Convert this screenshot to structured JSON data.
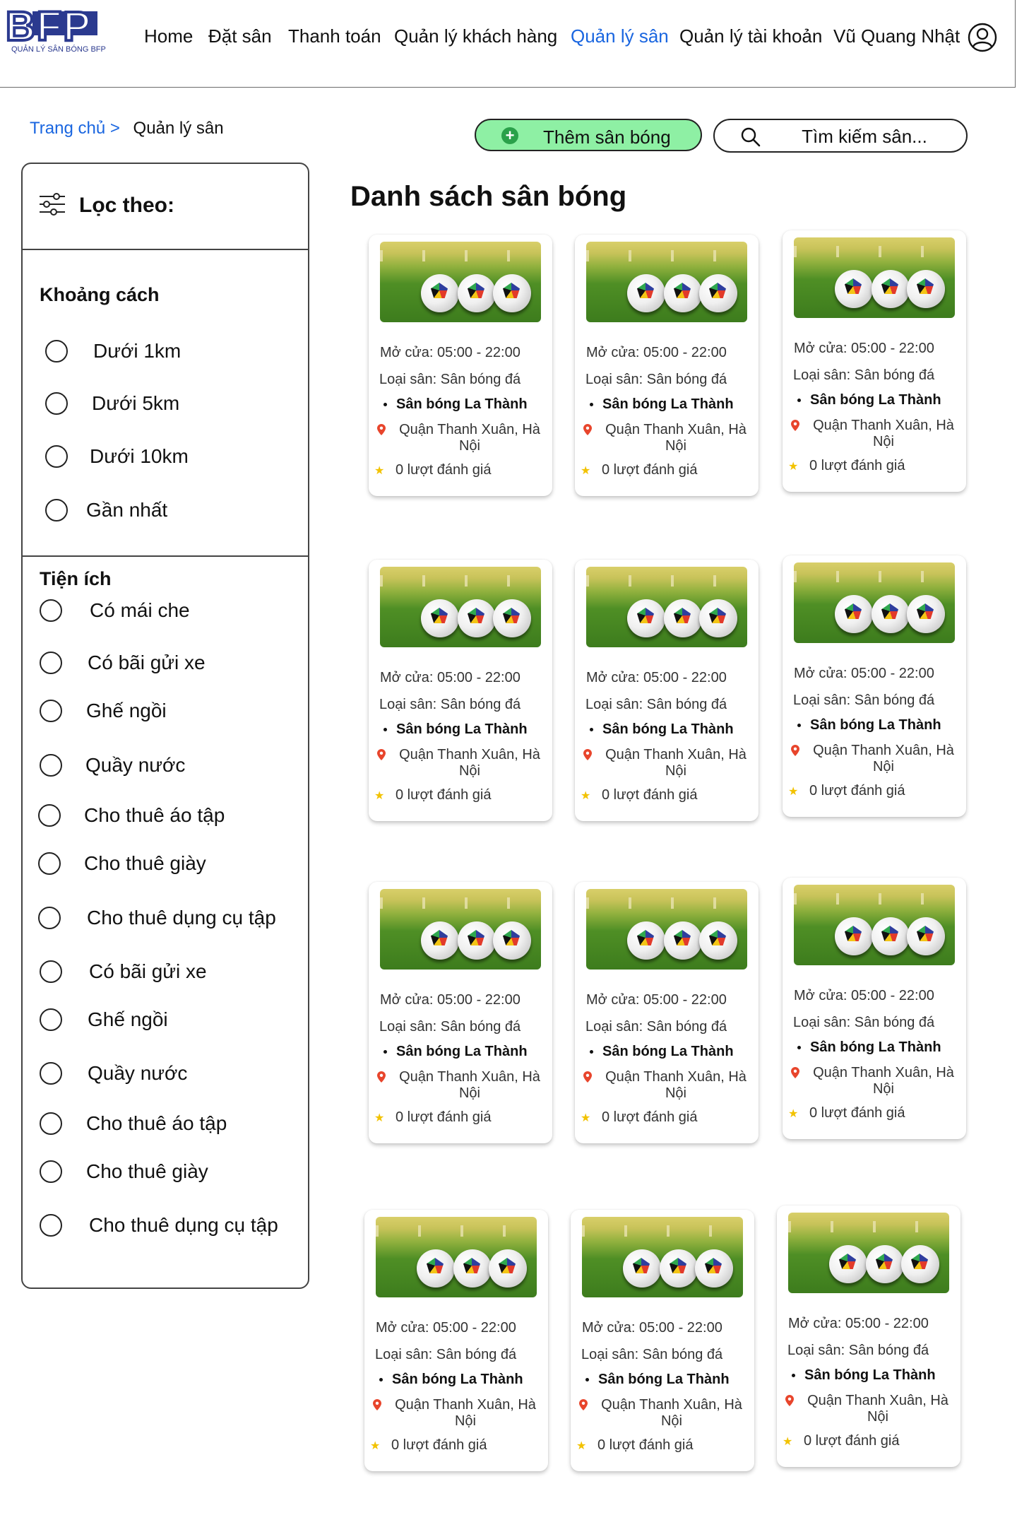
{
  "header": {
    "logo_text": "BFP",
    "logo_subtitle": "QUẢN LÝ SÂN BÓNG BFP",
    "nav": [
      {
        "label": "Home",
        "active": false
      },
      {
        "label": "Đặt sân",
        "active": false
      },
      {
        "label": "Thanh toán",
        "active": false
      },
      {
        "label": "Quản lý khách hàng",
        "active": false
      },
      {
        "label": "Quản lý sân",
        "active": true
      },
      {
        "label": "Quản lý tài khoản",
        "active": false
      },
      {
        "label": "Vũ Quang Nhật",
        "active": false
      }
    ]
  },
  "breadcrumb": {
    "home": "Trang chủ >",
    "current": "Quản lý sân"
  },
  "toolbar": {
    "add_label": "Thêm sân bóng",
    "search_placeholder": "Tìm kiếm sân..."
  },
  "filter": {
    "title": "Lọc theo:",
    "distance_title": "Khoảng cách",
    "distance_options": [
      "Dưới 1km",
      "Dưới 5km",
      "Dưới 10km",
      "Gần nhất"
    ],
    "amenities_title": "Tiện ích",
    "amenity_options": [
      "Có mái che",
      "Có bãi gửi xe",
      "Ghế ngồi",
      "Quầy nước",
      "Cho thuê áo tập",
      "Cho thuê giày",
      "Cho thuê dụng cụ tập",
      "Có bãi gửi xe",
      "Ghế ngồi",
      "Quầy nước",
      "Cho thuê áo tập",
      "Cho thuê giày",
      "Cho thuê dụng cụ tập"
    ]
  },
  "main": {
    "title": "Danh sách sân bóng",
    "cards": [
      {
        "open": "Mở cửa: 05:00 - 22:00",
        "type": "Loại sân: Sân bóng đá",
        "name": "Sân bóng La Thành",
        "address": "Quận Thanh Xuân, Hà Nội",
        "rating": "0 lượt đánh giá"
      },
      {
        "open": "Mở cửa: 05:00 - 22:00",
        "type": "Loại sân: Sân bóng đá",
        "name": "Sân bóng La Thành",
        "address": "Quận Thanh Xuân, Hà Nội",
        "rating": "0 lượt đánh giá"
      },
      {
        "open": "Mở cửa: 05:00 - 22:00",
        "type": "Loại sân: Sân bóng đá",
        "name": "Sân bóng La Thành",
        "address": "Quận Thanh Xuân, Hà Nội",
        "rating": "0 lượt đánh giá"
      },
      {
        "open": "Mở cửa: 05:00 - 22:00",
        "type": "Loại sân: Sân bóng đá",
        "name": "Sân bóng La Thành",
        "address": "Quận Thanh Xuân, Hà Nội",
        "rating": "0 lượt đánh giá"
      },
      {
        "open": "Mở cửa: 05:00 - 22:00",
        "type": "Loại sân: Sân bóng đá",
        "name": "Sân bóng La Thành",
        "address": "Quận Thanh Xuân, Hà Nội",
        "rating": "0 lượt đánh giá"
      },
      {
        "open": "Mở cửa: 05:00 - 22:00",
        "type": "Loại sân: Sân bóng đá",
        "name": "Sân bóng La Thành",
        "address": "Quận Thanh Xuân, Hà Nội",
        "rating": "0 lượt đánh giá"
      },
      {
        "open": "Mở cửa: 05:00 - 22:00",
        "type": "Loại sân: Sân bóng đá",
        "name": "Sân bóng La Thành",
        "address": "Quận Thanh Xuân, Hà Nội",
        "rating": "0 lượt đánh giá"
      },
      {
        "open": "Mở cửa: 05:00 - 22:00",
        "type": "Loại sân: Sân bóng đá",
        "name": "Sân bóng La Thành",
        "address": "Quận Thanh Xuân, Hà Nội",
        "rating": "0 lượt đánh giá"
      },
      {
        "open": "Mở cửa: 05:00 - 22:00",
        "type": "Loại sân: Sân bóng đá",
        "name": "Sân bóng La Thành",
        "address": "Quận Thanh Xuân, Hà Nội",
        "rating": "0 lượt đánh giá"
      },
      {
        "open": "Mở cửa: 05:00 - 22:00",
        "type": "Loại sân: Sân bóng đá",
        "name": "Sân bóng La Thành",
        "address": "Quận Thanh Xuân, Hà Nội",
        "rating": "0 lượt đánh giá"
      },
      {
        "open": "Mở cửa: 05:00 - 22:00",
        "type": "Loại sân: Sân bóng đá",
        "name": "Sân bóng La Thành",
        "address": "Quận Thanh Xuân, Hà Nội",
        "rating": "0 lượt đánh giá"
      },
      {
        "open": "Mở cửa: 05:00 - 22:00",
        "type": "Loại sân: Sân bóng đá",
        "name": "Sân bóng La Thành",
        "address": "Quận Thanh Xuân, Hà Nội",
        "rating": "0 lượt đánh giá"
      }
    ]
  },
  "colors": {
    "accent": "#1a66e0",
    "add_button": "#8ef0a4",
    "star": "#f2c200",
    "pin": "#e8452c"
  },
  "icons": [
    "user-icon",
    "plus-icon",
    "search-icon",
    "filter-icon",
    "location-pin-icon",
    "star-icon"
  ]
}
